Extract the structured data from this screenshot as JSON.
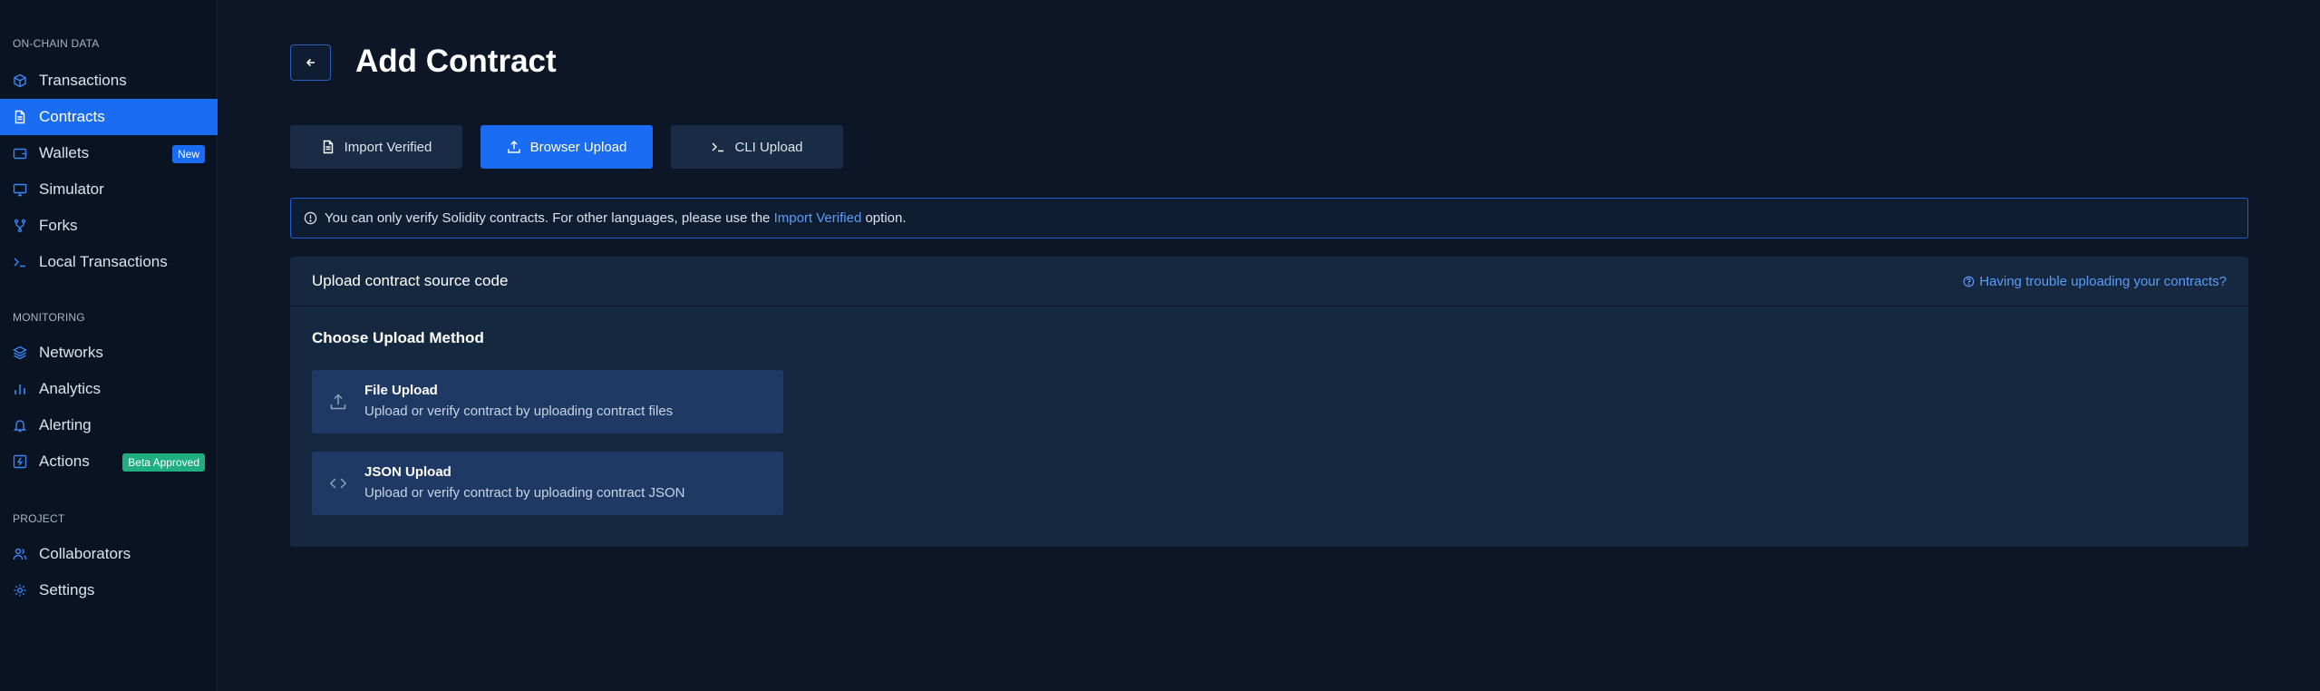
{
  "sidebar": {
    "sections": [
      {
        "title": "ON-CHAIN DATA",
        "items": [
          {
            "label": "Transactions",
            "icon": "cube-icon"
          },
          {
            "label": "Contracts",
            "icon": "document-icon",
            "active": true
          },
          {
            "label": "Wallets",
            "icon": "wallet-icon",
            "badge": "New"
          },
          {
            "label": "Simulator",
            "icon": "monitor-icon"
          },
          {
            "label": "Forks",
            "icon": "fork-icon"
          },
          {
            "label": "Local Transactions",
            "icon": "terminal-icon"
          }
        ]
      },
      {
        "title": "MONITORING",
        "items": [
          {
            "label": "Networks",
            "icon": "layers-icon"
          },
          {
            "label": "Analytics",
            "icon": "bar-chart-icon"
          },
          {
            "label": "Alerting",
            "icon": "bell-icon"
          },
          {
            "label": "Actions",
            "icon": "bolt-icon",
            "badge": "Beta Approved"
          }
        ]
      },
      {
        "title": "PROJECT",
        "items": [
          {
            "label": "Collaborators",
            "icon": "users-icon"
          },
          {
            "label": "Settings",
            "icon": "gear-icon"
          }
        ]
      }
    ]
  },
  "header": {
    "title": "Add Contract"
  },
  "tabs": [
    {
      "label": "Import Verified",
      "icon": "document-icon"
    },
    {
      "label": "Browser Upload",
      "icon": "upload-icon",
      "active": true
    },
    {
      "label": "CLI Upload",
      "icon": "terminal-icon"
    }
  ],
  "info_banner": {
    "text_before": "You can only verify Solidity contracts. For other languages, please use the",
    "link": "Import Verified",
    "text_after": "option."
  },
  "upload_card": {
    "title": "Upload contract source code",
    "help_link": "Having trouble uploading your contracts?",
    "method_title": "Choose Upload Method",
    "methods": [
      {
        "name": "File Upload",
        "description": "Upload or verify contract by uploading contract files",
        "icon": "upload-icon"
      },
      {
        "name": "JSON Upload",
        "description": "Upload or verify contract by uploading contract JSON",
        "icon": "code-icon"
      }
    ]
  },
  "colors": {
    "accent": "#1a6cf3",
    "background": "#0c1626",
    "sidebar": "#0a1322",
    "card": "#162840",
    "link": "#5a9cf7",
    "badge_beta": "#1fae80"
  }
}
